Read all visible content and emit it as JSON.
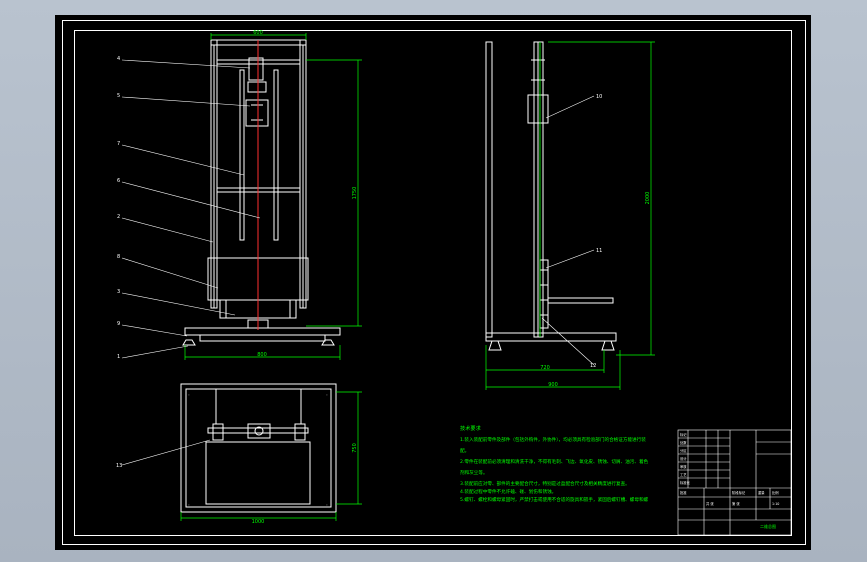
{
  "drawing": {
    "front_view": {
      "balloons": [
        "4",
        "5",
        "7",
        "6",
        "2",
        "8",
        "3",
        "9",
        "1"
      ],
      "dims": {
        "top_width": "600",
        "height": "1750",
        "base_width": "800"
      }
    },
    "side_view": {
      "balloons": [
        "10",
        "11",
        "12"
      ],
      "dims": {
        "height": "2000",
        "inner_width": "720",
        "base_width": "900"
      }
    },
    "plan_view": {
      "balloons": [
        "13"
      ],
      "dims": {
        "width": "1000",
        "depth": "750"
      }
    },
    "notes": {
      "title": "技术要求",
      "lines": [
        "1.装入装配前零件及部件（包括外购件，外协件），均必须具有检验部门的合格证方能进行装",
        "配。",
        "2.零件在装配前必须清理和清洗干净，不得有毛刺、飞边、氧化皮、锈蚀、切屑、油污、着色",
        "剂和灰尘等。",
        "3.装配前应对零、部件的主要配合尺寸，特别是过盈配合尺寸及相关精度进行复查。",
        "4.装配过程中零件不允许磕、碰、划伤和锈蚀。",
        "5.螺钉、螺栓和螺母紧固时，严禁打击或使用不合适的旋具和扳手，紧固后螺钉槽、螺母和螺"
      ]
    },
    "title_block": {
      "cells": [
        "标记",
        "处数",
        "分区",
        "设计",
        "审核",
        "工艺",
        "标准化",
        "批准",
        "阶段标记",
        "重量",
        "比例",
        "共 张",
        "第 张",
        "1:10"
      ],
      "drawing_name": "二维总图"
    }
  },
  "colors": {
    "background": "#b9c3cf",
    "sheet": "#000000",
    "line_white": "#ffffff",
    "dimension": "#00ff00",
    "centerline": "#ff3030",
    "notes": "#00ff00"
  }
}
